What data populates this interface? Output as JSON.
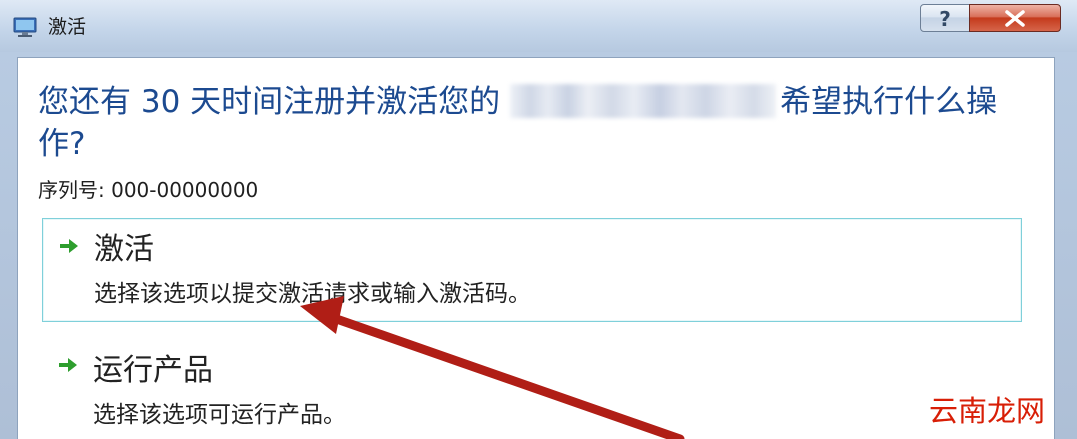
{
  "window": {
    "title": "激活",
    "help_label": "?",
    "close_icon": "close-x-icon"
  },
  "dialog": {
    "heading_prefix": "您还有 30 天时间注册并激活您的",
    "heading_suffix": "希望执行什么操作?",
    "serial_label": "序列号: 000-00000000"
  },
  "options": [
    {
      "title": "激活",
      "description": "选择该选项以提交激活请求或输入激活码。",
      "icon": "green-arrow-icon",
      "selected": true
    },
    {
      "title": "运行产品",
      "description": "选择该选项可运行产品。",
      "icon": "green-arrow-icon",
      "selected": false
    }
  ],
  "colors": {
    "heading": "#1c4a90",
    "selection_border": "#7fd0da",
    "arrow_green": "#2e9e2e",
    "annotation_arrow": "#b01e16",
    "watermark": "#d81e06"
  },
  "watermark": {
    "text": "云南龙网"
  }
}
